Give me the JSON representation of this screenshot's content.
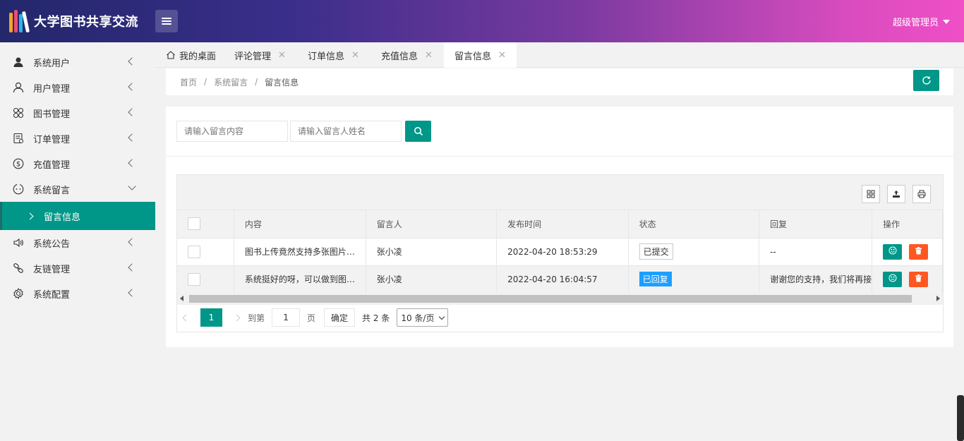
{
  "header": {
    "app_title": "大学图书共享交流",
    "user_name": "超级管理员"
  },
  "sidebar": {
    "items": [
      {
        "label": "系统用户",
        "icon": "user-solid-icon"
      },
      {
        "label": "用户管理",
        "icon": "user-outline-icon"
      },
      {
        "label": "图书管理",
        "icon": "grid-flower-icon"
      },
      {
        "label": "订单管理",
        "icon": "document-icon"
      },
      {
        "label": "充值管理",
        "icon": "dollar-icon"
      },
      {
        "label": "系统留言",
        "icon": "message-icon",
        "expanded": true
      },
      {
        "label": "系统公告",
        "icon": "speaker-icon"
      },
      {
        "label": "友链管理",
        "icon": "link-icon"
      },
      {
        "label": "系统配置",
        "icon": "gear-icon"
      }
    ],
    "active_sub": "留言信息"
  },
  "tabs": [
    {
      "label": "我的桌面",
      "icon": "home-icon"
    },
    {
      "label": "评论管理"
    },
    {
      "label": "订单信息"
    },
    {
      "label": "充值信息"
    },
    {
      "label": "留言信息",
      "active": true
    }
  ],
  "breadcrumb": {
    "home": "首页",
    "parent": "系统留言",
    "current": "留言信息",
    "separator": "/"
  },
  "search": {
    "content_placeholder": "请输入留言内容",
    "name_placeholder": "请输入留言人姓名"
  },
  "table": {
    "columns": [
      "内容",
      "留言人",
      "发布时间",
      "状态",
      "回复",
      "操作"
    ],
    "rows": [
      {
        "content": "图书上传竟然支持多张图片…",
        "author": "张小凌",
        "time": "2022-04-20 18:53:29",
        "status": "已提交",
        "reply": "--"
      },
      {
        "content": "系统挺好的呀，可以做到图…",
        "author": "张小凌",
        "time": "2022-04-20 16:04:57",
        "status": "已回复",
        "reply": "谢谢您的支持，我们将再接"
      }
    ]
  },
  "pagination": {
    "current_page": "1",
    "goto_label": "到第",
    "goto_value": "1",
    "page_unit": "页",
    "confirm": "确定",
    "total": "共 2 条",
    "page_size": "10 条/页"
  },
  "colors": {
    "primary": "#009688",
    "danger": "#ff5722",
    "info": "#1e9fff"
  }
}
